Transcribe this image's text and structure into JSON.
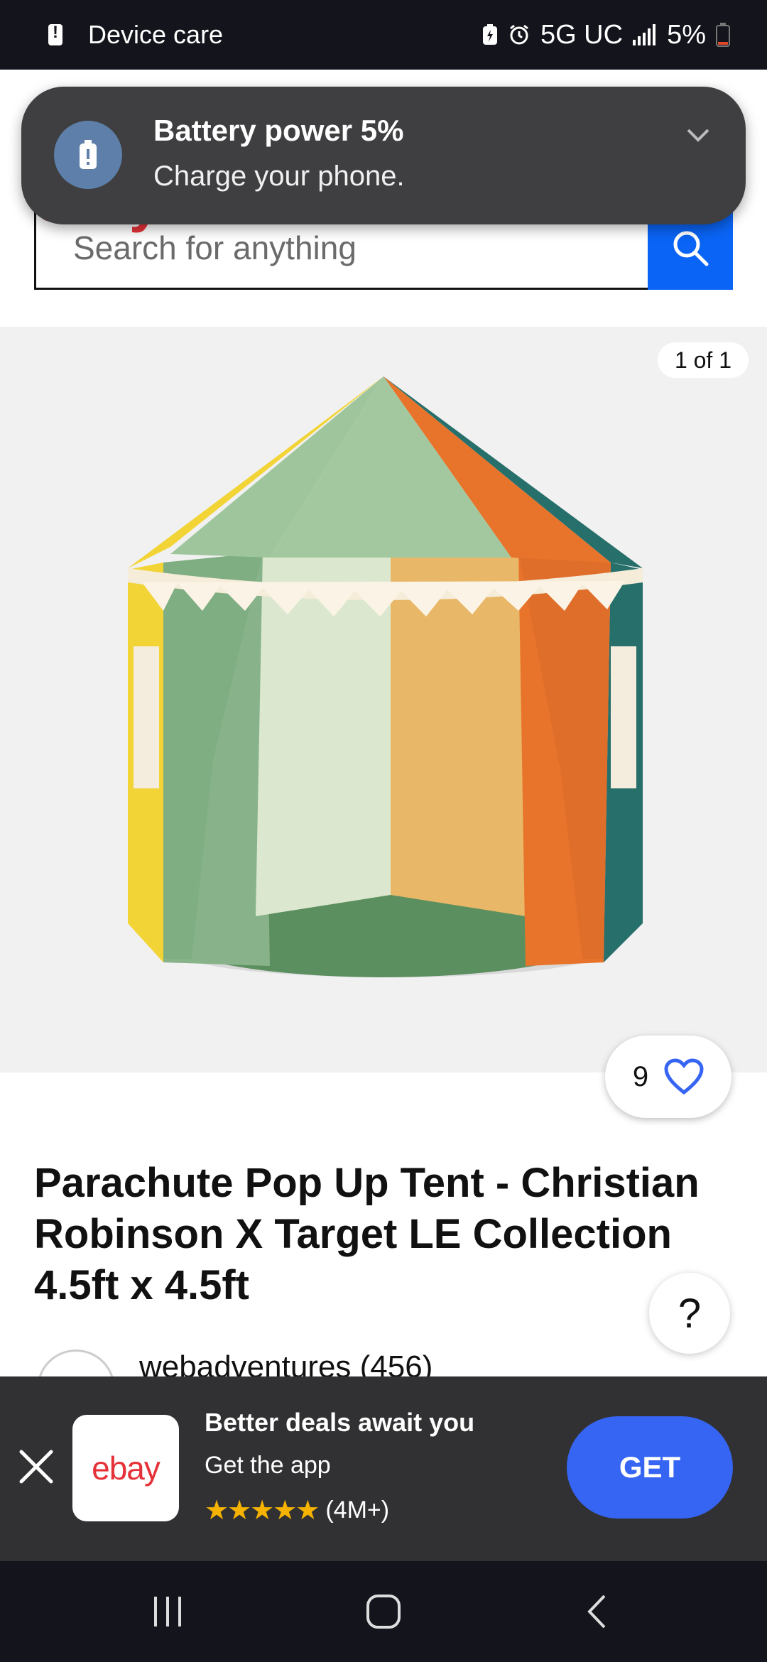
{
  "status_bar": {
    "left_label": "Device care",
    "network": "5G UC",
    "battery": "5%"
  },
  "header": {
    "logo": "ebay",
    "search_placeholder": "Search for anything"
  },
  "notification": {
    "title": "Battery power 5%",
    "body": "Charge your phone."
  },
  "gallery": {
    "counter": "1 of 1"
  },
  "watch": {
    "count": "9"
  },
  "product": {
    "title": "Parachute Pop Up Tent - Christian Robinson X Target LE Collection 4.5ft x 4.5ft",
    "seller": "webadventures (456)"
  },
  "help": {
    "label": "?"
  },
  "app_banner": {
    "logo_text": "ebay",
    "headline": "Better deals await you",
    "subtext": "Get the app",
    "stars": "★★★★★",
    "rating_count": "(4M+)",
    "get_label": "GET"
  },
  "colors": {
    "accent_blue": "#0a64f5",
    "get_button": "#3665f3",
    "notification_bg": "#3f3f41"
  },
  "icons": [
    "battery-alert-icon",
    "alarm-icon",
    "signal-icon",
    "battery-icon",
    "user-icon",
    "cart-icon",
    "chevron-down-icon",
    "menu-icon",
    "search-icon",
    "heart-icon",
    "close-icon",
    "recents-icon",
    "home-icon",
    "back-icon"
  ]
}
